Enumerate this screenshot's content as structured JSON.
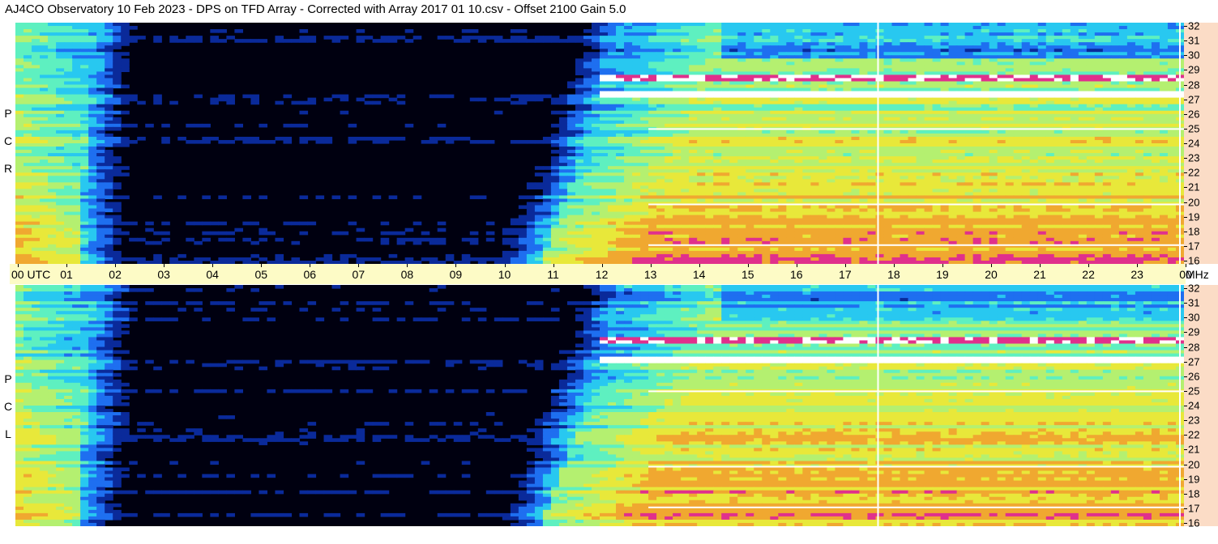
{
  "title": "AJ4CO Observatory  10 Feb 2023  -  DPS on TFD Array  -  Corrected with Array 2017 01 10.csv  -  Offset 2100  Gain 5.0",
  "panels": [
    {
      "label_letters": [
        "R",
        "C",
        "P"
      ]
    },
    {
      "label_letters": [
        "L",
        "C",
        "P"
      ]
    }
  ],
  "colors": {
    "background_dark": "#000010",
    "time_axis_bg": "#fdfbc6",
    "freq_axis_bg": "#fbdcc6",
    "marker_line": "#ffffff"
  },
  "time_axis": {
    "ticks": [
      "00 UTC",
      "01",
      "02",
      "03",
      "04",
      "05",
      "06",
      "07",
      "08",
      "09",
      "10",
      "11",
      "12",
      "13",
      "14",
      "15",
      "16",
      "17",
      "18",
      "19",
      "20",
      "21",
      "22",
      "23",
      "00"
    ],
    "unit_label": "MHz"
  },
  "freq_axis": {
    "ticks": [
      "32",
      "31",
      "30",
      "29",
      "28",
      "27",
      "26",
      "25",
      "24",
      "23",
      "22",
      "21",
      "20",
      "19",
      "18",
      "17",
      "16"
    ]
  },
  "chart_data": {
    "type": "heatmap",
    "title": "AJ4CO Observatory  10 Feb 2023  -  DPS on TFD Array  -  Corrected with Array 2017 01 10.csv  -  Offset 2100  Gain 5.0",
    "xlabel": "UTC",
    "ylabel": "MHz",
    "x_range_hours": [
      0,
      24
    ],
    "y_range_mhz": [
      16,
      32
    ],
    "series": [
      {
        "name": "RCP",
        "night_start_hour_approx": 1.8,
        "night_end_hour_approx": 12.8,
        "bright_band_mhz_approx": 27.2
      },
      {
        "name": "LCP",
        "night_start_hour_approx": 1.8,
        "night_end_hour_approx": 12.8,
        "bright_band_mhz_approx": 27.0
      }
    ],
    "markers_hour_approx": [
      17.7,
      23.9
    ],
    "colormap": [
      "#000010",
      "#0a2a9a",
      "#1e6ff0",
      "#28c8f0",
      "#5ef0c0",
      "#b4f070",
      "#e8e83a",
      "#f0a830",
      "#e0308c",
      "#ffffff"
    ]
  }
}
